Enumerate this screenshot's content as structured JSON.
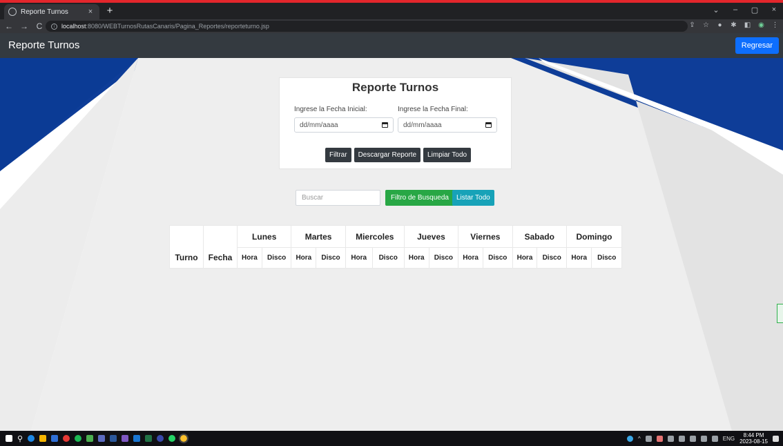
{
  "browser": {
    "tab_title": "Reporte Turnos",
    "tab_close": "×",
    "new_tab": "+",
    "url_host": "localhost",
    "url_path": ":8080/WEBTurnosRutasCanaris/Pagina_Reportes/reporteturno.jsp",
    "nav": {
      "back": "←",
      "forward": "→",
      "reload": "C"
    },
    "window_controls": {
      "dropdown": "⌄",
      "minimize": "–",
      "maximize": "▢",
      "close": "×"
    }
  },
  "navbar": {
    "brand": "Reporte Turnos",
    "back_button": "Regresar"
  },
  "filter_card": {
    "title": "Reporte Turnos",
    "start_label": "Ingrese la Fecha Inicial:",
    "end_label": "Ingrese la Fecha Final:",
    "start_placeholder": "dd/mm/aaaa",
    "end_placeholder": "dd/mm/aaaa",
    "buttons": {
      "filter": "Filtrar",
      "download": "Descargar Reporte",
      "clear": "Limpiar Todo"
    }
  },
  "search": {
    "placeholder": "Buscar",
    "filter_button": "Filtro de Busqueda",
    "list_button": "Listar Todo"
  },
  "table": {
    "col_turno": "Turno",
    "col_fecha": "Fecha",
    "days": [
      "Lunes",
      "Martes",
      "Miercoles",
      "Jueves",
      "Viernes",
      "Sabado",
      "Domingo"
    ],
    "sub_hora": "Hora",
    "sub_disco": "Disco"
  },
  "taskbar": {
    "tray_lang": "ENG",
    "time": "8:44 PM",
    "date": "2023-08-15"
  },
  "colors": {
    "navbar_bg": "#343a40",
    "primary_blue": "#0d6efd",
    "success_green": "#28a745",
    "info_cyan": "#17a2b8",
    "page_blue": "#0d3a93",
    "page_gray": "#ececec"
  }
}
